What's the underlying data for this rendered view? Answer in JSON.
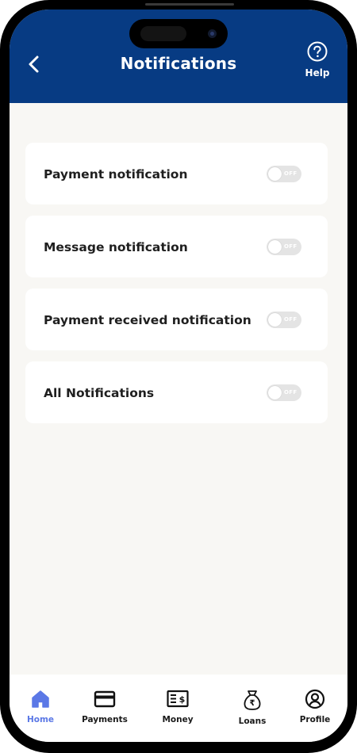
{
  "header": {
    "title": "Notifications",
    "help_label": "Help"
  },
  "settings": [
    {
      "label": "Payment notification",
      "state": "OFF"
    },
    {
      "label": "Message notification",
      "state": "OFF"
    },
    {
      "label": "Payment received notification",
      "state": "OFF"
    },
    {
      "label": "All Notifications",
      "state": "OFF"
    }
  ],
  "bottom_nav": {
    "items": [
      {
        "label": "Home",
        "icon": "home-icon",
        "active": true
      },
      {
        "label": "Payments",
        "icon": "card-icon",
        "active": false
      },
      {
        "label": "Money",
        "icon": "money-icon",
        "active": false
      },
      {
        "label": "Loans",
        "icon": "rupee-bag-icon",
        "active": false
      },
      {
        "label": "Profile",
        "icon": "profile-icon",
        "active": false
      }
    ]
  },
  "colors": {
    "header_bg": "#073b83",
    "page_bg": "#f8f7f4",
    "active_nav": "#5b78e6",
    "toggle_off": "#e4e4e4"
  }
}
